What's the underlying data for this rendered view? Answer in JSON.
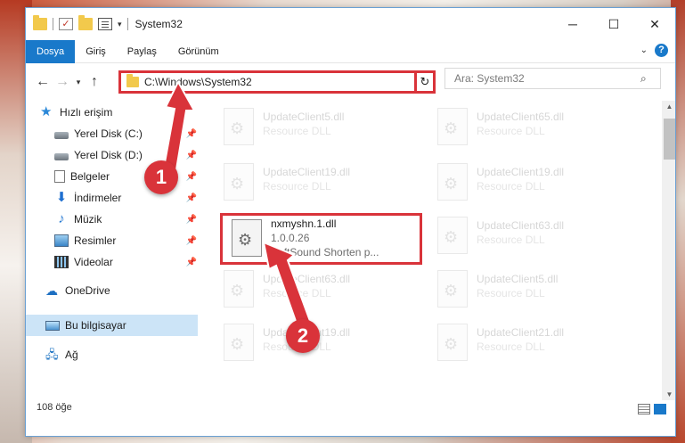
{
  "window": {
    "title": "System32",
    "controls": {
      "minimize": "─",
      "maximize": "☐",
      "close": "✕"
    }
  },
  "ribbon": {
    "tabs": [
      "Dosya",
      "Giriş",
      "Paylaş",
      "Görünüm"
    ],
    "active_tab": "Dosya",
    "expand_glyph": "⌄",
    "help_glyph": "?"
  },
  "nav": {
    "back": "←",
    "forward": "→",
    "recent": "▾",
    "up": "↑",
    "address": "C:\\Windows\\System32",
    "address_dropdown": "▾",
    "refresh": "↻"
  },
  "search": {
    "placeholder": "Ara: System32",
    "icon_glyph": "⌕"
  },
  "sidebar": {
    "quick_access": "Hızlı erişim",
    "items": [
      {
        "label": "Yerel Disk (C:)",
        "icon": "drive-icon",
        "pinned": true
      },
      {
        "label": "Yerel Disk (D:)",
        "icon": "drive-icon",
        "pinned": true
      },
      {
        "label": "Belgeler",
        "icon": "documents-icon",
        "pinned": true
      },
      {
        "label": "İndirmeler",
        "icon": "downloads-icon",
        "pinned": true
      },
      {
        "label": "Müzik",
        "icon": "music-icon",
        "pinned": true
      },
      {
        "label": "Resimler",
        "icon": "pictures-icon",
        "pinned": true
      },
      {
        "label": "Videolar",
        "icon": "videos-icon",
        "pinned": true
      }
    ],
    "onedrive": "OneDrive",
    "this_pc": "Bu bilgisayar",
    "network": "Ağ",
    "pin_glyph": "📌"
  },
  "files": {
    "items": [
      {
        "name": "UpdateClient5.dll",
        "sub": "Resource DLL"
      },
      {
        "name": "UpdateClient65.dll",
        "sub": "Resource DLL"
      },
      {
        "name": "UpdateClient19.dll",
        "sub": "Resource DLL"
      },
      {
        "name": "UpdateClient19.dll",
        "sub": "Resource DLL"
      },
      {
        "name": "nxmyshn.1.dll",
        "version": "1.0.0.26",
        "description": "SoftSound Shorten p..."
      },
      {
        "name": "UpdateClient63.dll",
        "sub": "Resource DLL"
      },
      {
        "name": "UpdateClient63.dll",
        "sub": "Resource DLL"
      },
      {
        "name": "UpdateClient5.dll",
        "sub": "Resource DLL"
      },
      {
        "name": "UpdateClient19.dll",
        "sub": "Resource DLL"
      },
      {
        "name": "UpdateClient21.dll",
        "sub": "Resource DLL"
      }
    ]
  },
  "status": {
    "count": "108 öğe"
  },
  "callouts": {
    "one": "1",
    "two": "2"
  },
  "colors": {
    "accent": "#1979ca",
    "highlight": "#d9333a",
    "selected": "#cce4f7"
  }
}
